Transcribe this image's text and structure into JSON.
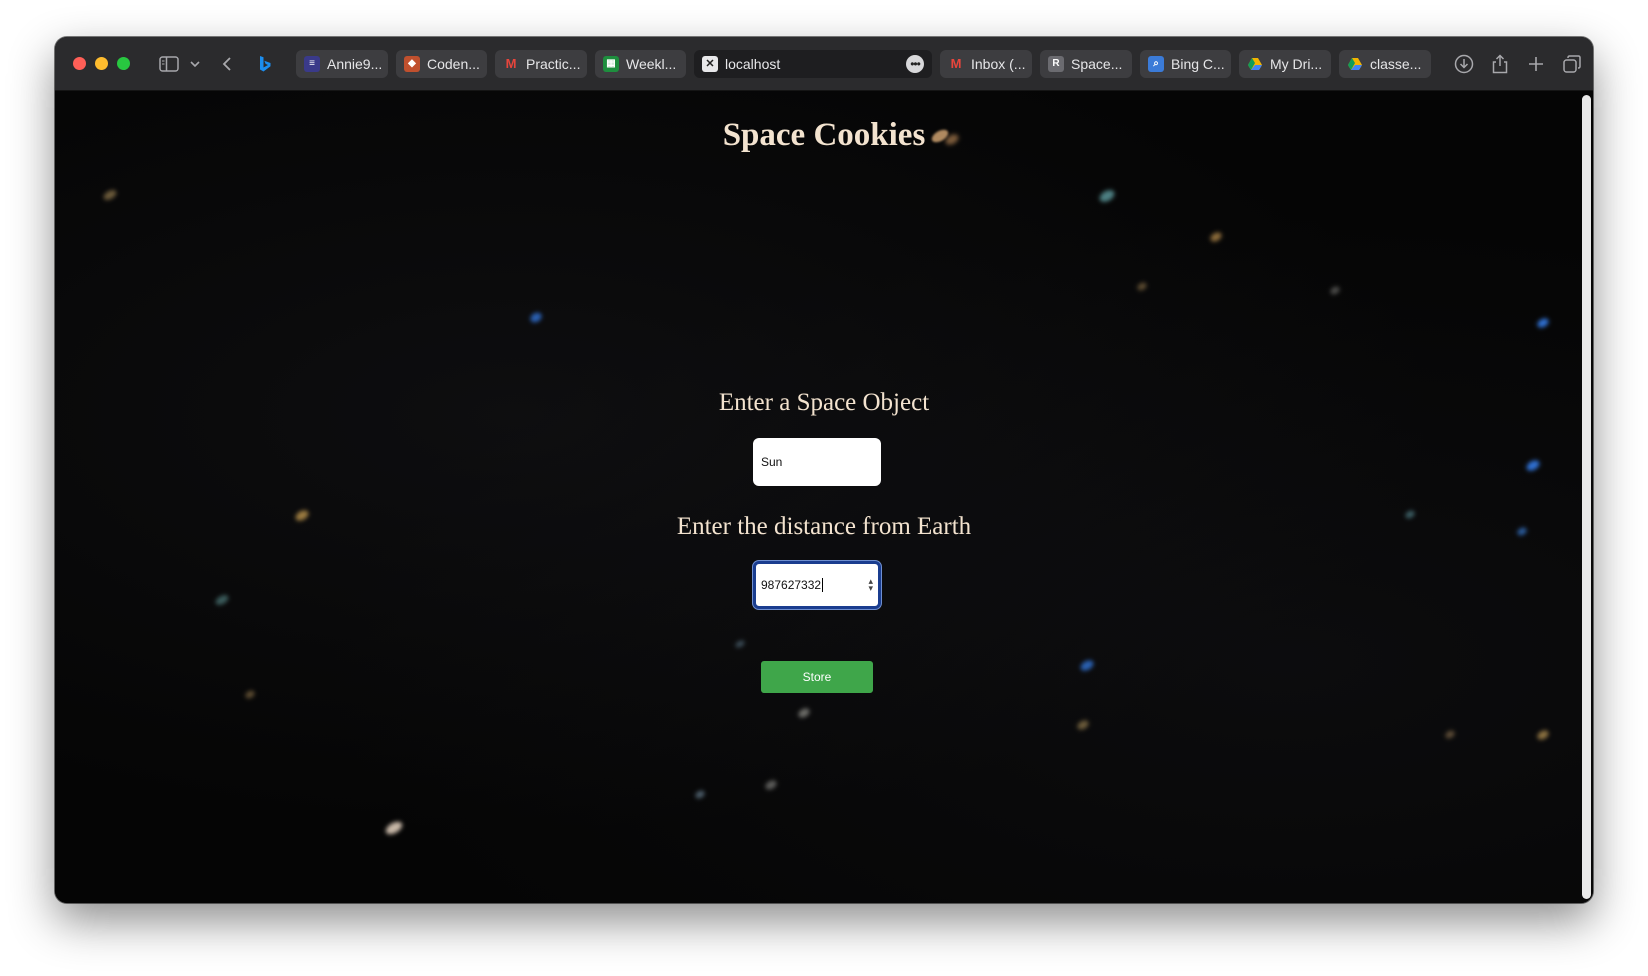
{
  "browser": {
    "tabs": [
      {
        "label": "Annie9...",
        "icon": "document-icon",
        "color": "#3a3a8a"
      },
      {
        "label": "Coden...",
        "icon": "codenames-icon",
        "color": "#c0502e"
      },
      {
        "label": "Practic...",
        "icon": "gmail-icon",
        "color": "#d93025"
      },
      {
        "label": "Weekl...",
        "icon": "sheets-icon",
        "color": "#1e8e3e"
      }
    ],
    "active_tab": {
      "label": "localhost",
      "icon": "close-icon"
    },
    "tabs_right": [
      {
        "label": "Inbox (...",
        "icon": "gmail-icon",
        "color": "#d93025"
      },
      {
        "label": "Space...",
        "icon": "replit-icon",
        "letter": "R",
        "color": "#6b6b70"
      },
      {
        "label": "Bing C...",
        "icon": "bing-search-icon",
        "color": "#3b7bd8"
      },
      {
        "label": "My Dri...",
        "icon": "drive-icon",
        "color": "#f4b400"
      },
      {
        "label": "classe...",
        "icon": "drive-icon",
        "color": "#f4b400"
      }
    ]
  },
  "page": {
    "title": "Space Cookies",
    "object_label": "Enter a Space Object",
    "object_value": "Sun",
    "distance_label": "Enter the distance from Earth",
    "distance_value": "987627332",
    "store_label": "Store"
  },
  "colors": {
    "background": "#050505",
    "heading": "#f3e3cf",
    "button": "#3fa64a",
    "focus_ring": "#1a3d8f"
  }
}
